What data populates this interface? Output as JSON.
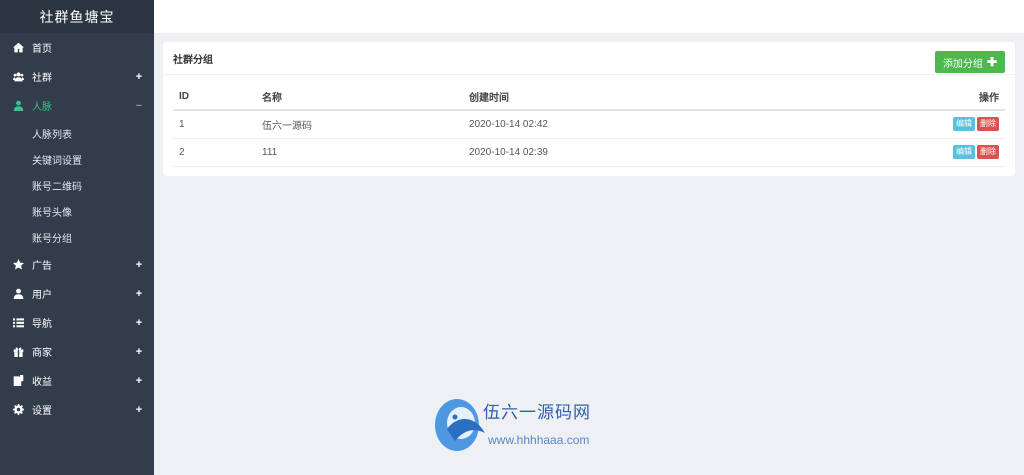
{
  "brand": "社群鱼塘宝",
  "menu": [
    {
      "label": "首页",
      "icon": "home-icon",
      "toggle": ""
    },
    {
      "label": "社群",
      "icon": "group-icon",
      "toggle": "+"
    },
    {
      "label": "人脉",
      "icon": "user-icon",
      "toggle": "−",
      "active": true,
      "children": [
        "人脉列表",
        "关键词设置",
        "账号二维码",
        "账号头像",
        "账号分组"
      ]
    },
    {
      "label": "广告",
      "icon": "star-icon",
      "toggle": "+"
    },
    {
      "label": "用户",
      "icon": "user-icon",
      "toggle": "+"
    },
    {
      "label": "导航",
      "icon": "list-icon",
      "toggle": "+"
    },
    {
      "label": "商家",
      "icon": "gift-icon",
      "toggle": "+"
    },
    {
      "label": "收益",
      "icon": "document-icon",
      "toggle": "+"
    },
    {
      "label": "设置",
      "icon": "gear-icon",
      "toggle": "+"
    }
  ],
  "panel": {
    "title": "社群分组",
    "add_button": "添加分组",
    "columns": {
      "id": "ID",
      "name": "名称",
      "created": "创建时间",
      "ops": "操作"
    },
    "rows": [
      {
        "id": "1",
        "name": "伍六一源码",
        "created": "2020-10-14 02:42",
        "edit": "编辑",
        "delete": "删除"
      },
      {
        "id": "2",
        "name": "111",
        "created": "2020-10-14 02:39",
        "edit": "编辑",
        "delete": "删除"
      }
    ]
  },
  "watermark": {
    "title": "伍六一源码网",
    "url": "www.hhhhaaa.com"
  },
  "colors": {
    "sidebar": "#323c4a",
    "active": "#38c28f",
    "add": "#4cb84e",
    "edit": "#5bc0de",
    "delete": "#d9534f"
  }
}
